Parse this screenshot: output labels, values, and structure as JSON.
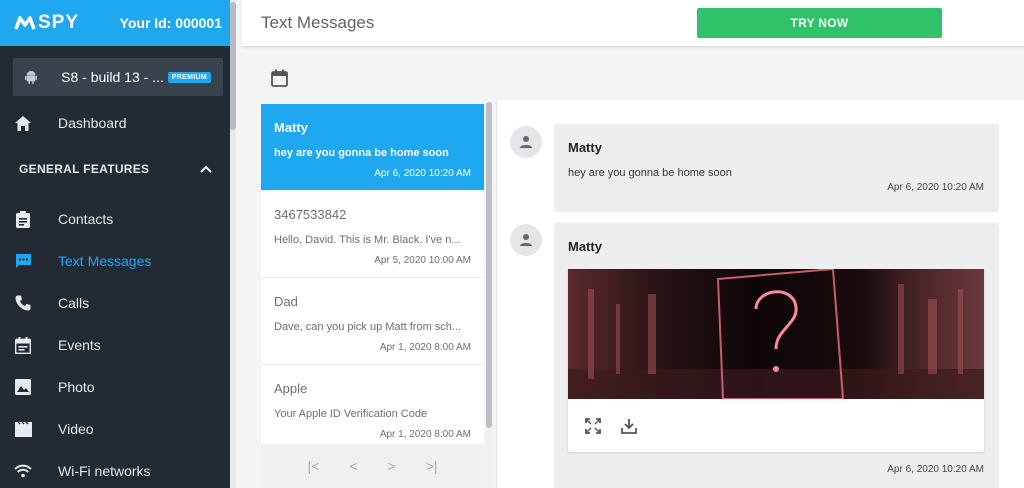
{
  "brand": {
    "logo_text": "SPY",
    "your_id": "Your Id: 000001",
    "accent": "#1fa8f0"
  },
  "device": {
    "name": "S8 - build 13 - ...",
    "badge": "PREMIUM"
  },
  "sidebar": {
    "dashboard": "Dashboard",
    "section_title": "GENERAL FEATURES",
    "items": [
      {
        "label": "Contacts",
        "icon": "contacts-icon"
      },
      {
        "label": "Text Messages",
        "icon": "chat-icon",
        "active": true
      },
      {
        "label": "Calls",
        "icon": "phone-icon"
      },
      {
        "label": "Events",
        "icon": "events-icon"
      },
      {
        "label": "Photo",
        "icon": "photo-icon"
      },
      {
        "label": "Video",
        "icon": "video-icon"
      },
      {
        "label": "Wi-Fi networks",
        "icon": "wifi-icon"
      }
    ]
  },
  "header": {
    "title": "Text Messages",
    "cta": "TRY NOW",
    "cta_color": "#2fc26a"
  },
  "conversations": [
    {
      "name": "Matty",
      "preview": "hey are you gonna be home soon",
      "date": "Apr 6, 2020 10:20 AM"
    },
    {
      "name": "3467533842",
      "preview": "Hello, David. This is Mr. Black. I've n...",
      "date": "Apr 5, 2020 10:00 AM"
    },
    {
      "name": "Dad",
      "preview": "Dave, can you pick up Matt from sch...",
      "date": "Apr 1, 2020 8:00 AM"
    },
    {
      "name": "Apple",
      "preview": "Your Apple ID Verification Code",
      "date": "Apr 1, 2020 8:00 AM"
    }
  ],
  "pager": {
    "first": "|<",
    "prev": "<",
    "next": ">",
    "last": ">|"
  },
  "messages": [
    {
      "sender": "Matty",
      "text": "hey are you gonna be home soon",
      "date": "Apr 6, 2020 10:20 AM"
    },
    {
      "sender": "Matty",
      "date": "Apr 6, 2020 10:20 AM"
    }
  ]
}
